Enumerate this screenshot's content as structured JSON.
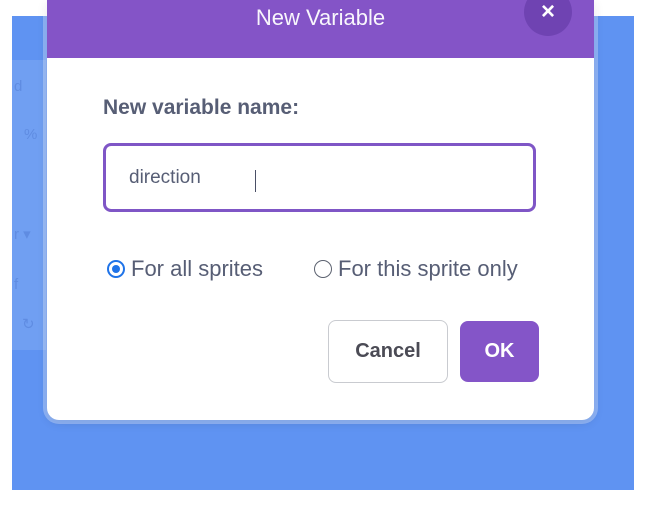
{
  "dialog": {
    "title": "New Variable",
    "close_glyph": "×",
    "field_label": "New variable name:",
    "input_value": "direction",
    "scope_options": [
      {
        "label": "For all sprites",
        "selected": true
      },
      {
        "label": "For this sprite only",
        "selected": false
      }
    ],
    "cancel_label": "Cancel",
    "ok_label": "OK"
  },
  "background_fragments": [
    "d",
    "%",
    "r ▾",
    "f",
    "↻"
  ],
  "colors": {
    "header": "#8454c7",
    "accent": "#7f56c6",
    "ok_button": "#8455c8",
    "backdrop": "#5f93f2",
    "radio_selected": "#1f73e8"
  },
  "icons": {
    "close": "close-icon",
    "radio_selected": "radio-selected-icon",
    "radio_unselected": "radio-unselected-icon"
  }
}
